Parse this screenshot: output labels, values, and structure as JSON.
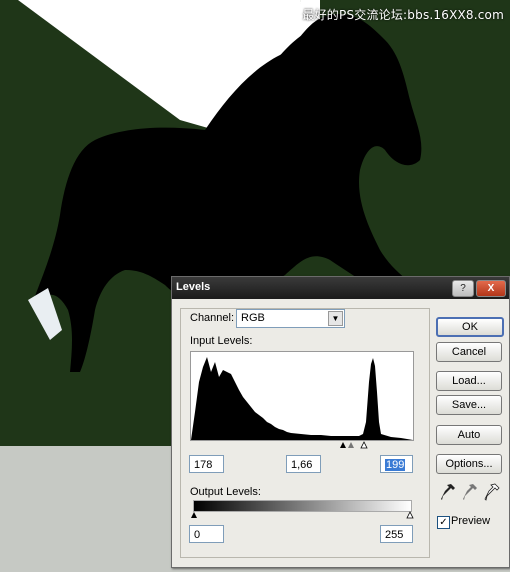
{
  "watermark": "最好的PS交流论坛:bbs.16XX8.com",
  "dialog": {
    "title": "Levels",
    "channel_label": "Channel:",
    "channel_value": "RGB",
    "input_levels_label": "Input Levels:",
    "input_black": "178",
    "input_gamma": "1,66",
    "input_white": "199",
    "output_levels_label": "Output Levels:",
    "output_black": "0",
    "output_white": "255",
    "buttons": {
      "ok": "OK",
      "cancel": "Cancel",
      "load": "Load...",
      "save": "Save...",
      "auto": "Auto",
      "options": "Options..."
    },
    "preview_label": "Preview",
    "preview_checked": true,
    "help_glyph": "?",
    "close_glyph": "X"
  },
  "colors": {
    "background_green": "#1f3618",
    "floor_gray": "#c6c9c4",
    "selection_blue": "#3a7bd5"
  }
}
